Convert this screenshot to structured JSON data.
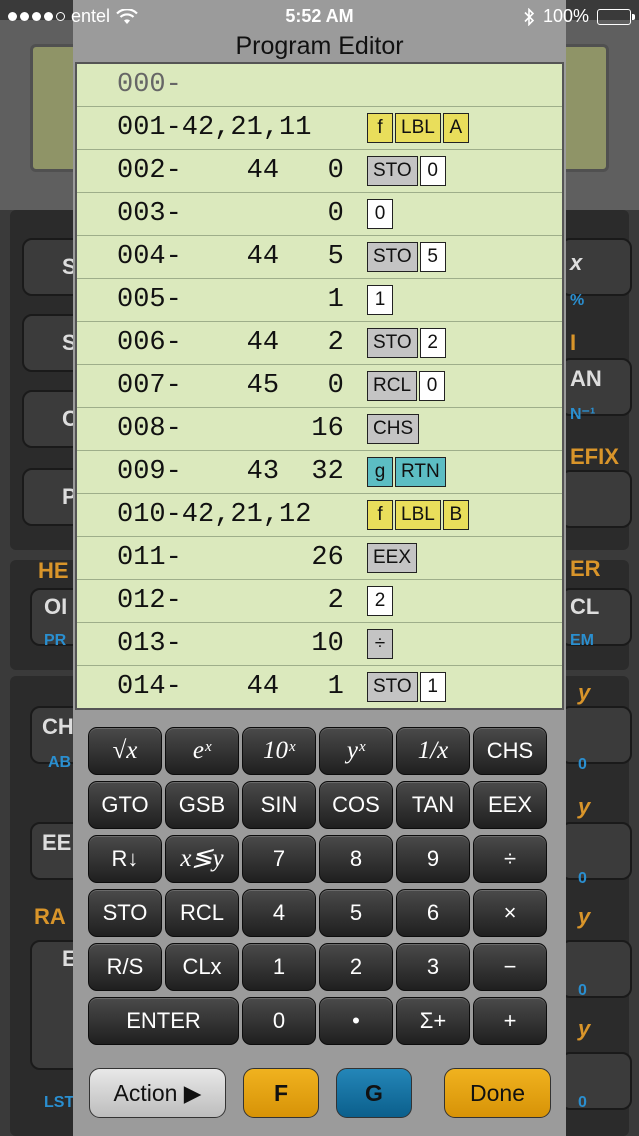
{
  "status_bar": {
    "carrier": "entel",
    "time": "5:52 AM",
    "battery": "100%",
    "battery_level": 1.0
  },
  "editor": {
    "title": "Program Editor",
    "rows": [
      {
        "code": "000-",
        "keys": []
      },
      {
        "code": "001-42,21,11",
        "keys": [
          {
            "label": "f",
            "style": "yellow"
          },
          {
            "label": "LBL",
            "style": "yellow"
          },
          {
            "label": "A",
            "style": "yellow"
          }
        ]
      },
      {
        "code": "002-    44   0",
        "keys": [
          {
            "label": "STO",
            "style": "gray"
          },
          {
            "label": "0",
            "style": "white"
          }
        ]
      },
      {
        "code": "003-         0",
        "keys": [
          {
            "label": "0",
            "style": "white"
          }
        ]
      },
      {
        "code": "004-    44   5",
        "keys": [
          {
            "label": "STO",
            "style": "gray"
          },
          {
            "label": "5",
            "style": "white"
          }
        ]
      },
      {
        "code": "005-         1",
        "keys": [
          {
            "label": "1",
            "style": "white"
          }
        ]
      },
      {
        "code": "006-    44   2",
        "keys": [
          {
            "label": "STO",
            "style": "gray"
          },
          {
            "label": "2",
            "style": "white"
          }
        ]
      },
      {
        "code": "007-    45   0",
        "keys": [
          {
            "label": "RCL",
            "style": "gray"
          },
          {
            "label": "0",
            "style": "white"
          }
        ]
      },
      {
        "code": "008-        16",
        "keys": [
          {
            "label": "CHS",
            "style": "gray"
          }
        ]
      },
      {
        "code": "009-    43  32",
        "keys": [
          {
            "label": "g",
            "style": "teal"
          },
          {
            "label": "RTN",
            "style": "teal"
          }
        ]
      },
      {
        "code": "010-42,21,12",
        "keys": [
          {
            "label": "f",
            "style": "yellow"
          },
          {
            "label": "LBL",
            "style": "yellow"
          },
          {
            "label": "B",
            "style": "yellow"
          }
        ]
      },
      {
        "code": "011-        26",
        "keys": [
          {
            "label": "EEX",
            "style": "gray"
          }
        ]
      },
      {
        "code": "012-         2",
        "keys": [
          {
            "label": "2",
            "style": "white"
          }
        ]
      },
      {
        "code": "013-        10",
        "keys": [
          {
            "label": "÷",
            "style": "gray"
          }
        ]
      },
      {
        "code": "014-    44   1",
        "keys": [
          {
            "label": "STO",
            "style": "gray"
          },
          {
            "label": "1",
            "style": "white"
          }
        ]
      }
    ]
  },
  "keypad": {
    "rows": [
      [
        {
          "label": "√x",
          "name": "sqrt-key",
          "italic": true
        },
        {
          "label": "eˣ",
          "name": "exp-key",
          "italic": true
        },
        {
          "label": "10ˣ",
          "name": "ten-power-key",
          "italic": true
        },
        {
          "label": "yˣ",
          "name": "power-key",
          "italic": true
        },
        {
          "label": "1/x",
          "name": "reciprocal-key",
          "italic": true
        },
        {
          "label": "CHS",
          "name": "chs-key"
        }
      ],
      [
        {
          "label": "GTO",
          "name": "gto-key"
        },
        {
          "label": "GSB",
          "name": "gsb-key"
        },
        {
          "label": "SIN",
          "name": "sin-key"
        },
        {
          "label": "COS",
          "name": "cos-key"
        },
        {
          "label": "TAN",
          "name": "tan-key"
        },
        {
          "label": "EEX",
          "name": "eex-key"
        }
      ],
      [
        {
          "label": "R↓",
          "name": "roll-down-key"
        },
        {
          "label": "x≶y",
          "name": "swap-key",
          "italic": true
        },
        {
          "label": "7",
          "name": "digit-7-key"
        },
        {
          "label": "8",
          "name": "digit-8-key"
        },
        {
          "label": "9",
          "name": "digit-9-key"
        },
        {
          "label": "÷",
          "name": "divide-key"
        }
      ],
      [
        {
          "label": "STO",
          "name": "sto-key"
        },
        {
          "label": "RCL",
          "name": "rcl-key"
        },
        {
          "label": "4",
          "name": "digit-4-key"
        },
        {
          "label": "5",
          "name": "digit-5-key"
        },
        {
          "label": "6",
          "name": "digit-6-key"
        },
        {
          "label": "×",
          "name": "multiply-key"
        }
      ],
      [
        {
          "label": "R/S",
          "name": "run-stop-key"
        },
        {
          "label": "CLx",
          "name": "clx-key"
        },
        {
          "label": "1",
          "name": "digit-1-key"
        },
        {
          "label": "2",
          "name": "digit-2-key"
        },
        {
          "label": "3",
          "name": "digit-3-key"
        },
        {
          "label": "−",
          "name": "subtract-key"
        }
      ],
      [
        {
          "label": "ENTER",
          "name": "enter-key",
          "wide": true
        },
        {
          "label": "0",
          "name": "digit-0-key"
        },
        {
          "label": "•",
          "name": "decimal-key"
        },
        {
          "label": "Σ+",
          "name": "sigma-plus-key"
        },
        {
          "label": "+",
          "name": "add-key"
        }
      ]
    ],
    "action_label": "Action ▶",
    "f_label": "F",
    "g_label": "G",
    "done_label": "Done"
  },
  "background": {
    "labels": [
      "S",
      "S",
      "C",
      "P",
      "HE",
      "OI",
      "PR",
      "CH",
      "AB",
      "EE",
      "RA",
      "LST",
      "E",
      "x",
      "%",
      "I",
      "AN",
      "N⁻¹",
      "EFIX",
      "ER",
      "CL",
      "EM",
      "y",
      "0",
      "y",
      "0",
      "y",
      "0",
      "y",
      "0"
    ],
    "colors": {
      "orange": "#d9952a",
      "blue": "#2a8fd0"
    }
  }
}
